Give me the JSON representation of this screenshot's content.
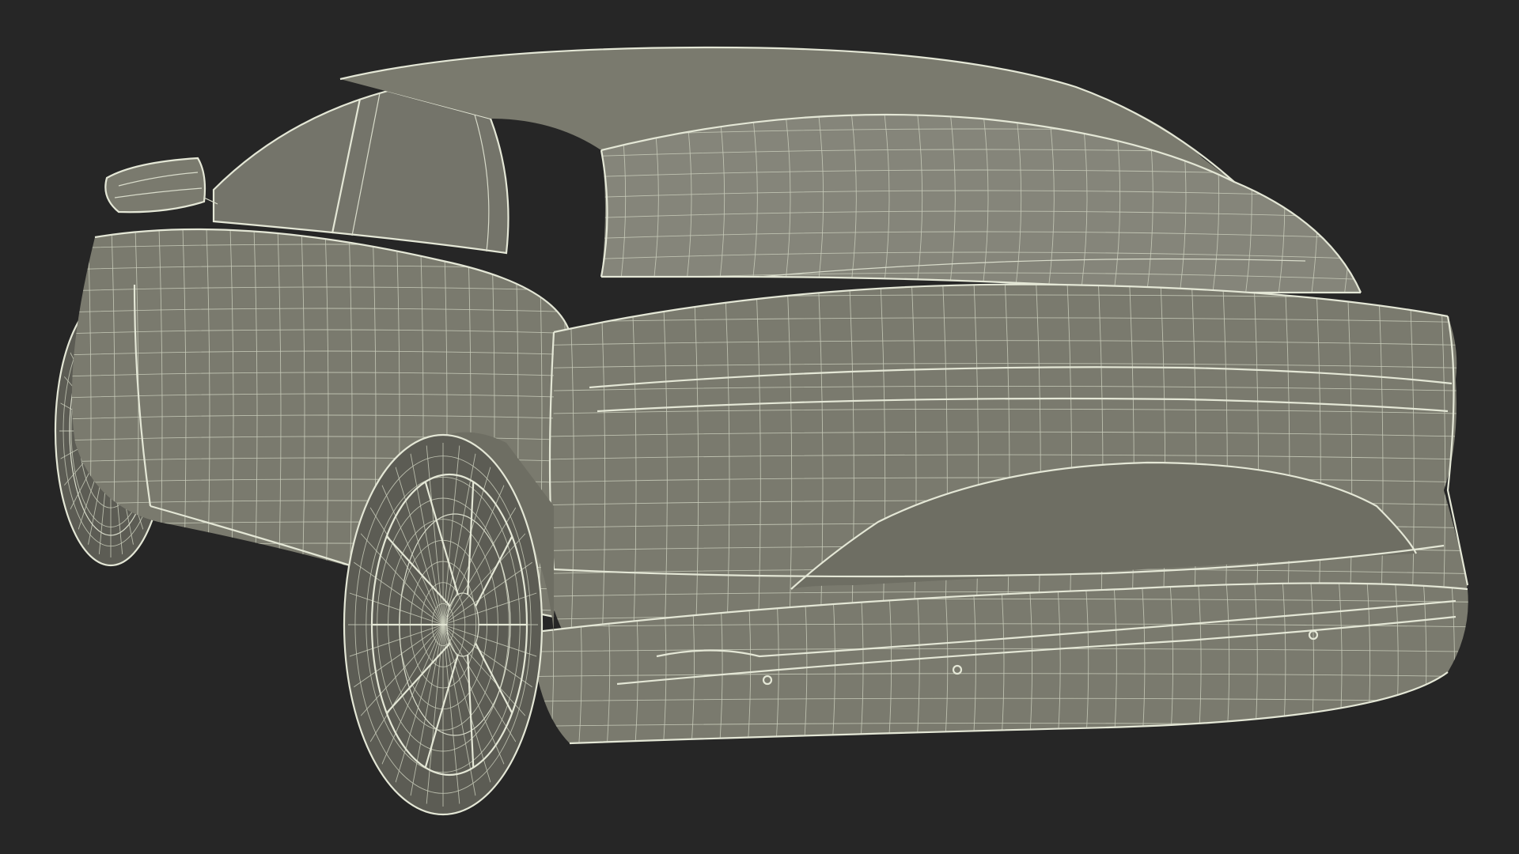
{
  "scene": {
    "subject": "car-wireframe",
    "background_color": "#262626",
    "body_color": "#7a7a6e",
    "wire_color": "#d9dccb"
  }
}
